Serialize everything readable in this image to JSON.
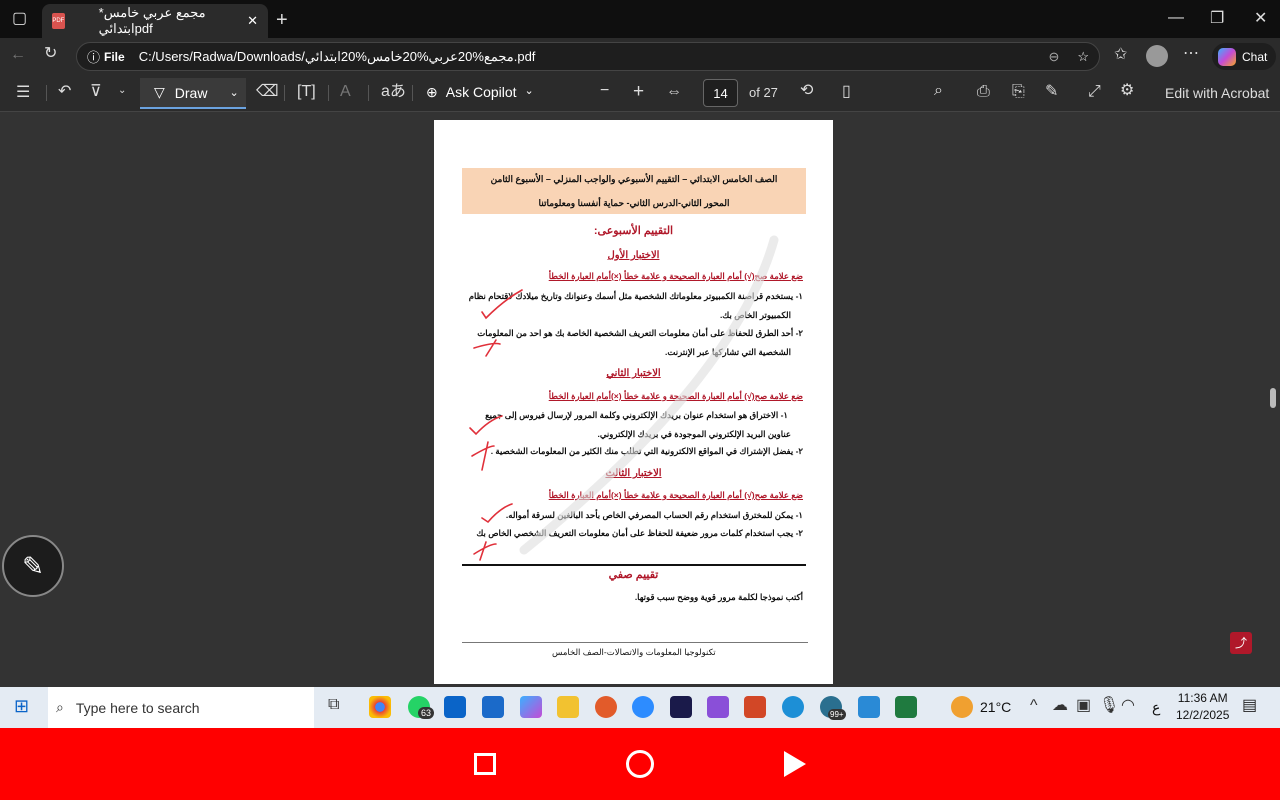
{
  "browser": {
    "tab_title": "*مجمع عربي خامس ابتدائيpdf",
    "address_scheme": "File",
    "url": "C:/Users/Radwa/Downloads/مجمع%20عربي%20خامس%20ابتدائي.pdf",
    "chat_label": "Chat"
  },
  "toolbar": {
    "draw_label": "Draw",
    "ask_copilot_label": "Ask Copilot",
    "page_current": "14",
    "page_total": "of 27",
    "edit_acrobat_label": "Edit with Acrobat"
  },
  "document": {
    "header_line1": "الصف الخامس الابتدائي – التقييم الأسبوعي والواجب المنزلي – الأسبوع الثامن",
    "header_line2": "المحور الثاني-الدرس الثاني- حماية أنفسنا ومعلوماتنا",
    "weekly_title": "التقييم الأسبوعى:",
    "test1_title": "الاختبار الأول",
    "instruction": "ضع علامة صح(√) أمام العبارة الصحيحة و علامة خطأ (×)أمام العبارة الخطأ",
    "t1_q1a": "١- يستخدم قراصنة الكمبيوتر معلوماتك الشخصية مثل أسمك وعنوانك وتاريخ ميلادك لاقتحام نظام",
    "t1_q1b": "الكمبيوتر الخاص بك.",
    "t1_q2a": "٢- أحد الطرق للحفاظ على أمان معلومات التعريف الشخصية الخاصة بك هو احد من المعلومات",
    "t1_q2b": "الشخصية التي تشاركها عبر الإنترنت.",
    "test2_title": "الاختبار الثاني",
    "t2_q1a": "١- الاختراق هو استخدام عنوان بريدك الإلكتروني وكلمة المرور لإرسال فيروس إلى جميع",
    "t2_q1b": "عناوين البريد الإلكتروني الموجودة في بريدك الإلكتروني.",
    "t2_q2": "٢- يفضل الإشتراك في المواقع الالكترونية التي تطلب منك الكثير من المعلومات الشخصية .",
    "test3_title": "الاختبار الثالث",
    "t3_q1": "١- يمكن للمخترق استخدام رقم الحساب المصرفي الخاص بأحد البالغين لسرقة أمواله.",
    "t3_q2": "٢- يجب استخدام كلمات مرور ضعيفة للحفاظ على أمان معلومات التعريف الشخصي الخاص بك",
    "class_eval_title": "تقييم صفي",
    "class_eval_task": "أكتب نموذجا لكلمة مرور قوية ووضح سبب قوتها.",
    "footer": "تكنولوجيا المعلومات والاتصالات-الصف الخامس",
    "bracket": "(      )"
  },
  "taskbar": {
    "search_placeholder": "Type here to search",
    "whatsapp_badge": "63",
    "edge_badge": "99+",
    "weather": "21°C",
    "lang": "ع",
    "time": "11:36 AM",
    "date": "12/2/2025"
  },
  "colors": {
    "accent_red": "#b0182a",
    "header_bg": "#f9d4b5",
    "recorder_bar": "#ff0000"
  }
}
